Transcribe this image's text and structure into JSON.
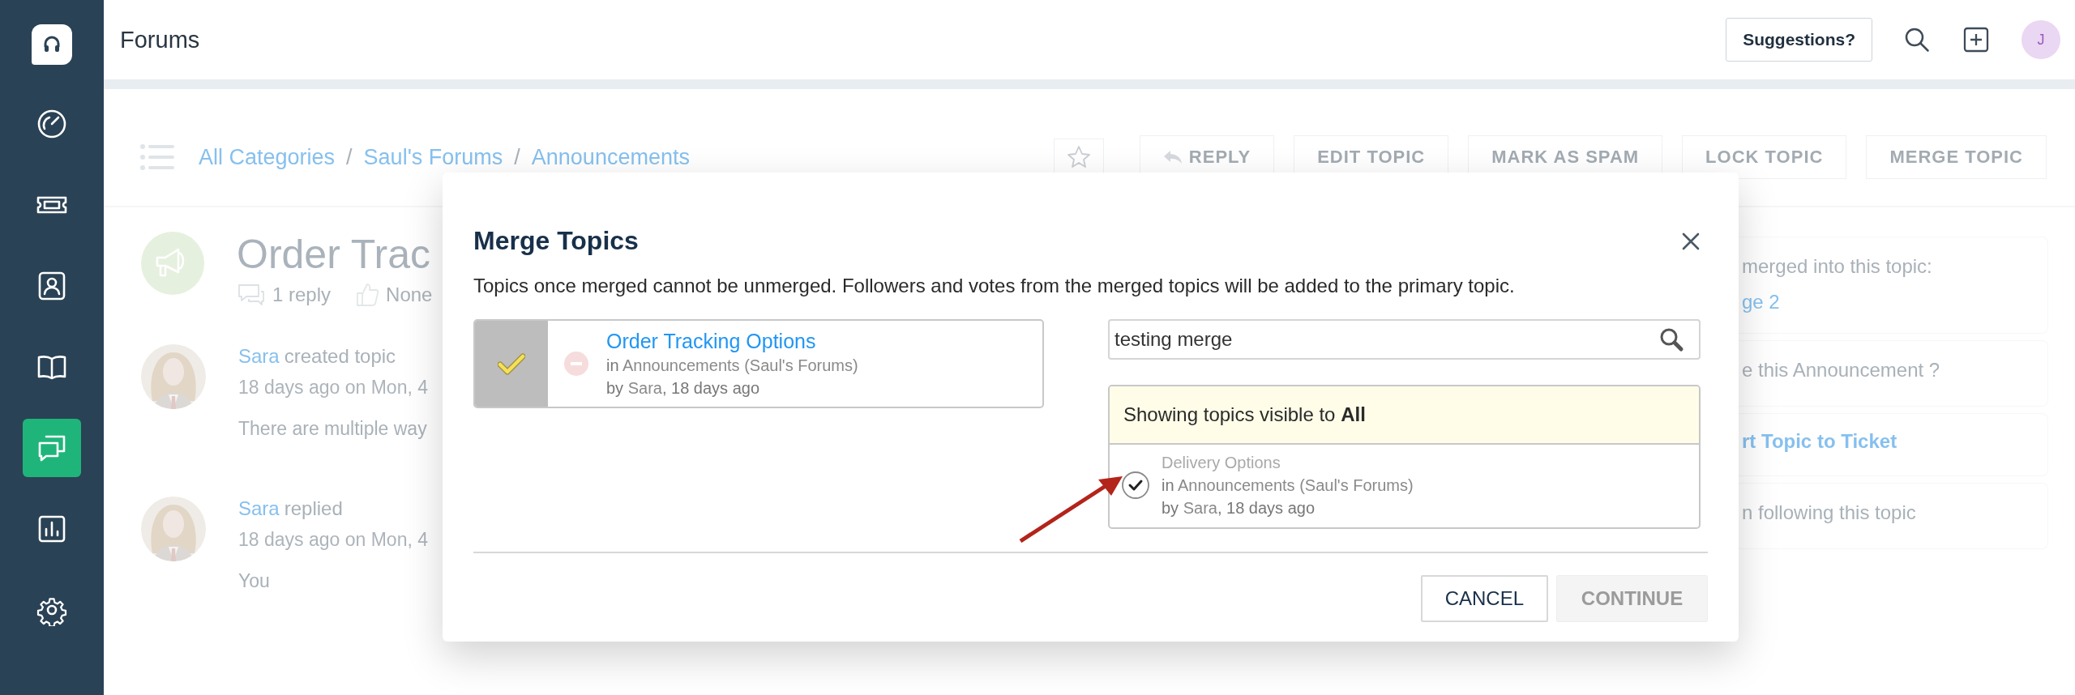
{
  "sidebar": {
    "items": [
      {
        "selected": false
      },
      {
        "selected": false
      },
      {
        "selected": false
      },
      {
        "selected": false
      },
      {
        "selected": true
      },
      {
        "selected": false
      }
    ]
  },
  "top_bar": {
    "title": "Forums",
    "suggestions_button": "Suggestions?",
    "avatar_initial": "J"
  },
  "toolbar": {
    "breadcrumbs": [
      {
        "kind": "link",
        "text": "All Categories"
      },
      {
        "kind": "separator",
        "text": "/"
      },
      {
        "kind": "link",
        "text": "Saul's Forums"
      },
      {
        "kind": "separator",
        "text": "/"
      },
      {
        "kind": "link",
        "text": "Announcements"
      }
    ],
    "actions": [
      {
        "kind": "reply",
        "label": "REPLY"
      },
      {
        "kind": "plain",
        "label": "EDIT TOPIC"
      },
      {
        "kind": "plain",
        "label": "MARK AS SPAM"
      },
      {
        "kind": "plain",
        "label": "LOCK TOPIC"
      },
      {
        "kind": "plain",
        "label": "MERGE TOPIC"
      }
    ]
  },
  "topic": {
    "title": "Order Trac",
    "replies": "1 reply",
    "votes": "None"
  },
  "posts": [
    {
      "author": "Sara",
      "action": "created topic",
      "date": "18 days ago on Mon, 4",
      "body": "There are multiple way"
    },
    {
      "author": "Sara",
      "action": "replied",
      "date": "18 days ago on Mon, 4",
      "body": "You"
    }
  ],
  "side_panel": {
    "cards": [
      {
        "lines": [
          {
            "kind": "text",
            "text": "merged into this topic:"
          },
          {
            "kind": "link",
            "text": "ge 2"
          }
        ]
      },
      {
        "lines": [
          {
            "kind": "text",
            "text": "e this Announcement ?"
          }
        ]
      },
      {
        "lines": [
          {
            "kind": "action",
            "text": "rt Topic to Ticket"
          }
        ]
      },
      {
        "lines": [
          {
            "kind": "text",
            "text": "n following this topic"
          }
        ]
      }
    ]
  },
  "modal": {
    "title": "Merge Topics",
    "description": "Topics once merged cannot be unmerged. Followers and votes from the merged topics will be added to the primary topic.",
    "primary_topic": {
      "title": "Order Tracking Options",
      "location_prefix": "in",
      "location": "Announcements (Saul's Forums)",
      "author_prefix": "by",
      "author": "Sara",
      "age": ", 18 days ago"
    },
    "search": {
      "value": "testing merge"
    },
    "results_notice": "Showing topics visible to **All**",
    "results": [
      {
        "title": "Delivery Options",
        "location_prefix": "in",
        "location": "Announcements (Saul's Forums)",
        "author_prefix": "by",
        "author": "Sara",
        "age": ", 18 days ago",
        "checked": true
      }
    ],
    "buttons": [
      {
        "kind": "secondary",
        "label": "CANCEL",
        "disabled": false
      },
      {
        "kind": "primary",
        "label": "CONTINUE",
        "disabled": true
      }
    ]
  }
}
